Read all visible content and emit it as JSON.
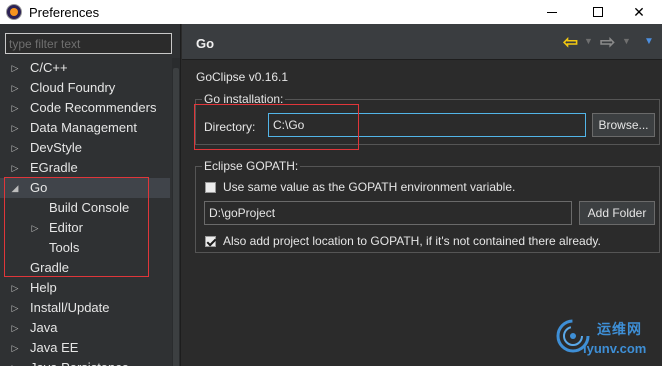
{
  "window": {
    "title": "Preferences",
    "minimize_icon": "minimize-icon",
    "maximize_icon": "maximize-icon",
    "close_glyph": "✕"
  },
  "sidebar": {
    "filter_placeholder": "type filter text",
    "items": [
      {
        "label": "C/C++",
        "level": 0,
        "arrow": "collapsed"
      },
      {
        "label": "Cloud Foundry",
        "level": 0,
        "arrow": "collapsed"
      },
      {
        "label": "Code Recommenders",
        "level": 0,
        "arrow": "collapsed"
      },
      {
        "label": "Data Management",
        "level": 0,
        "arrow": "collapsed"
      },
      {
        "label": "DevStyle",
        "level": 0,
        "arrow": "collapsed"
      },
      {
        "label": "EGradle",
        "level": 0,
        "arrow": "collapsed"
      },
      {
        "label": "Go",
        "level": 0,
        "arrow": "expanded",
        "selected": true
      },
      {
        "label": "Build Console",
        "level": 1,
        "arrow": "none"
      },
      {
        "label": "Editor",
        "level": 1,
        "arrow": "collapsed"
      },
      {
        "label": "Tools",
        "level": 1,
        "arrow": "none"
      },
      {
        "label": "Gradle",
        "level": 0,
        "arrow": "none"
      },
      {
        "label": "Help",
        "level": 0,
        "arrow": "collapsed"
      },
      {
        "label": "Install/Update",
        "level": 0,
        "arrow": "collapsed"
      },
      {
        "label": "Java",
        "level": 0,
        "arrow": "collapsed"
      },
      {
        "label": "Java EE",
        "level": 0,
        "arrow": "collapsed"
      },
      {
        "label": "Java Persistence",
        "level": 0,
        "arrow": "collapsed"
      }
    ]
  },
  "page": {
    "title": "Go",
    "version": "GoClipse v0.16.1",
    "go_installation": {
      "group_title": "Go installation:",
      "directory_label": "Directory:",
      "directory_value": "C:\\Go",
      "browse_label": "Browse..."
    },
    "gopath": {
      "group_title": "Eclipse GOPATH:",
      "use_same_label": "Use same value as the GOPATH environment variable.",
      "use_same_checked": false,
      "path_value": "D:\\goProject",
      "add_folder_label": "Add Folder",
      "also_add_label": "Also add project location to GOPATH, if it's not contained there already.",
      "also_add_checked": true
    }
  },
  "nav": {
    "back_icon": "back-arrow-icon",
    "forward_icon": "forward-arrow-icon",
    "menu_icon": "view-menu-icon"
  },
  "watermark": {
    "top": "运维网",
    "bottom": "iyunv.com"
  },
  "colors": {
    "annotation": "#e0363a",
    "focus_border": "#52b5e8",
    "back_arrow": "#f2c811"
  }
}
